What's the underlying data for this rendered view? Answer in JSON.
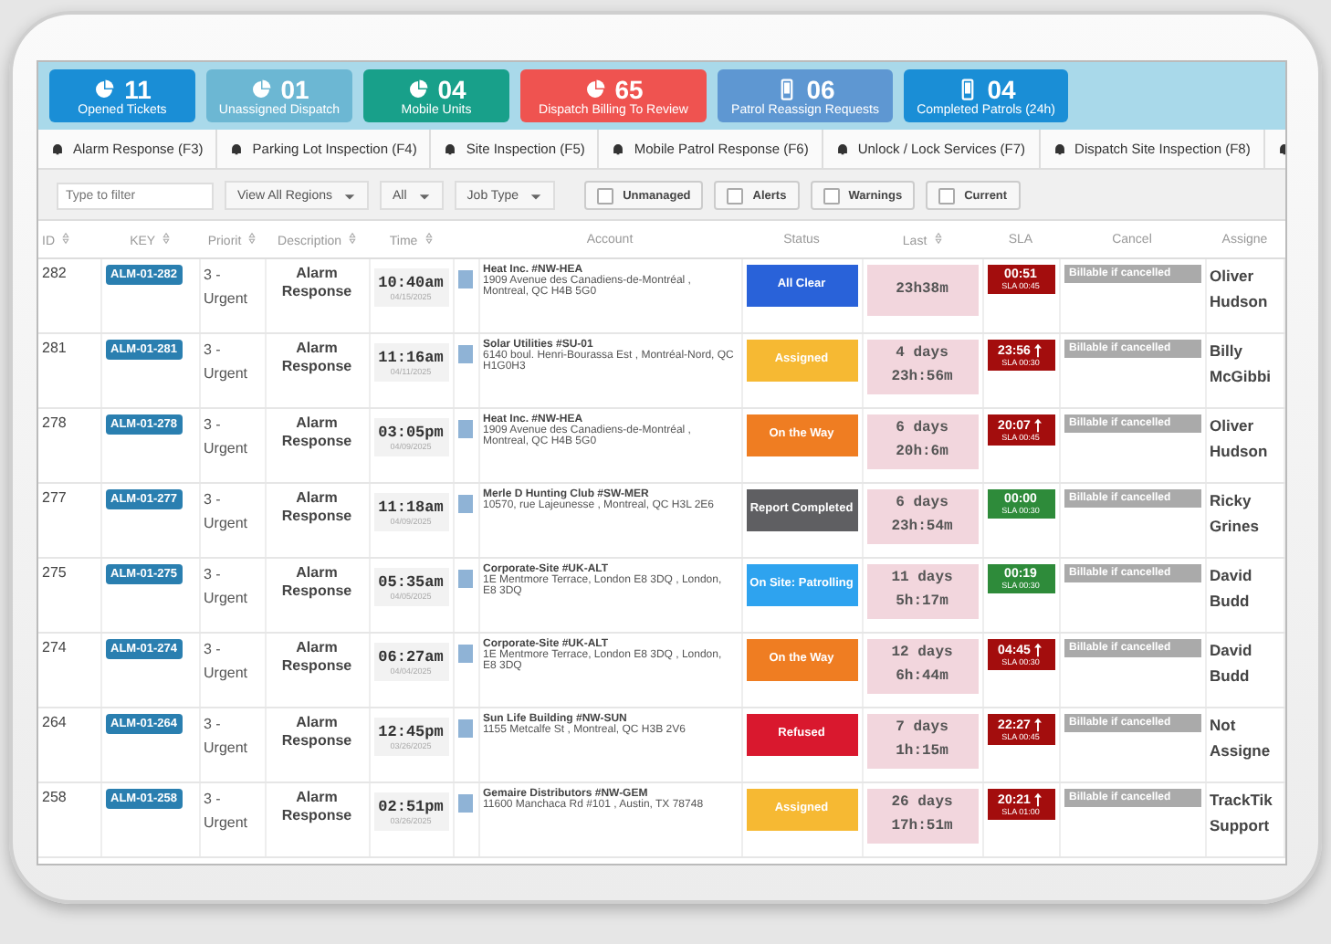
{
  "tiles": [
    {
      "count": "11",
      "label": "Opened Tickets",
      "kind": "pie",
      "color": "#1a8ed6"
    },
    {
      "count": "01",
      "label": "Unassigned Dispatch",
      "kind": "pie",
      "color": "#6cb7d3"
    },
    {
      "count": "04",
      "label": "Mobile Units",
      "kind": "pie",
      "color": "#18a08a"
    },
    {
      "count": "65",
      "label": "Dispatch Billing To Review",
      "kind": "pie",
      "color": "#ef5350"
    },
    {
      "count": "06",
      "label": "Patrol Reassign Requests",
      "kind": "phone",
      "color": "#5e97d2"
    },
    {
      "count": "04",
      "label": "Completed Patrols (24h)",
      "kind": "phone",
      "color": "#1a8ed6"
    }
  ],
  "tabs": [
    {
      "label": "Alarm Response (F3)"
    },
    {
      "label": "Parking Lot Inspection (F4)"
    },
    {
      "label": "Site Inspection (F5)"
    },
    {
      "label": "Mobile Patrol Response (F6)"
    },
    {
      "label": "Unlock / Lock Services (F7)"
    },
    {
      "label": "Dispatch Site Inspection (F8)"
    }
  ],
  "filters": {
    "search": {
      "placeholder": "Type to filter"
    },
    "selects": [
      "View All Regions",
      "All",
      "Job Type"
    ],
    "checkboxes": [
      {
        "label": "Unmanaged",
        "checked": false
      },
      {
        "label": "Alerts",
        "checked": false
      },
      {
        "label": "Warnings",
        "checked": false
      },
      {
        "label": "Current",
        "checked": false
      }
    ]
  },
  "table": {
    "columns": [
      {
        "label": "ID",
        "sortable": true
      },
      {
        "label": "KEY",
        "sortable": true
      },
      {
        "label": "Priorit",
        "sortable": true
      },
      {
        "label": "Description",
        "sortable": true
      },
      {
        "label": "Time",
        "sortable": true
      },
      {
        "sortable": false
      },
      {
        "label": "Account",
        "sortable": false
      },
      {
        "label": "Status",
        "sortable": false
      },
      {
        "label": "Last",
        "sortable": true
      },
      {
        "label": "SLA",
        "sortable": false
      },
      {
        "label": "Cancel",
        "sortable": false
      },
      {
        "label": "Assigne",
        "sortable": false
      }
    ],
    "rows": [
      {
        "id": "282",
        "key": "ALM-01-282",
        "priority": "3 - Urgent",
        "description": "Alarm Response",
        "time": "10:40am",
        "date": "04/15/2025",
        "account_name": "Heat Inc. #NW-HEA",
        "address": "1909 Avenue des Canadiens-de-Montréal , Montreal, QC H4B 5G0",
        "status": {
          "label": "All Clear",
          "color": "#2962d9"
        },
        "last": [
          "23h38m"
        ],
        "sla": {
          "elapsed": "00:51",
          "limit": "SLA 00:45",
          "color": "#a30d0d",
          "overdue": false
        },
        "cancel": "Billable if cancelled",
        "assignee": "Oliver Hudson"
      },
      {
        "id": "281",
        "key": "ALM-01-281",
        "priority": "3 - Urgent",
        "description": "Alarm Response",
        "time": "11:16am",
        "date": "04/11/2025",
        "account_name": "Solar Utilities #SU-01",
        "address": "6140 boul. Henri-Bourassa Est , Montréal-Nord, QC H1G0H3",
        "status": {
          "label": "Assigned",
          "color": "#f6b933"
        },
        "last": [
          "4 days",
          "23h:56m"
        ],
        "sla": {
          "elapsed": "23:56",
          "limit": "SLA 00:30",
          "color": "#a30d0d",
          "overdue": true
        },
        "cancel": "Billable if cancelled",
        "assignee": "Billy McGibbi"
      },
      {
        "id": "278",
        "key": "ALM-01-278",
        "priority": "3 - Urgent",
        "description": "Alarm Response",
        "time": "03:05pm",
        "date": "04/09/2025",
        "account_name": "Heat Inc. #NW-HEA",
        "address": "1909 Avenue des Canadiens-de-Montréal , Montreal, QC H4B 5G0",
        "status": {
          "label": "On the Way",
          "color": "#ef7d22"
        },
        "last": [
          "6 days",
          "20h:6m"
        ],
        "sla": {
          "elapsed": "20:07",
          "limit": "SLA 00:45",
          "color": "#a30d0d",
          "overdue": true
        },
        "cancel": "Billable if cancelled",
        "assignee": "Oliver Hudson"
      },
      {
        "id": "277",
        "key": "ALM-01-277",
        "priority": "3 - Urgent",
        "description": "Alarm Response",
        "time": "11:18am",
        "date": "04/09/2025",
        "account_name": "Merle D Hunting Club #SW-MER",
        "address": "10570, rue Lajeunesse , Montreal, QC H3L 2E6",
        "status": {
          "label": "Report Completed",
          "color": "#5f5f62"
        },
        "last": [
          "6 days",
          "23h:54m"
        ],
        "sla": {
          "elapsed": "00:00",
          "limit": "SLA 00:30",
          "color": "#2e8b3a",
          "overdue": false
        },
        "cancel": "Billable if cancelled",
        "assignee": "Ricky Grines"
      },
      {
        "id": "275",
        "key": "ALM-01-275",
        "priority": "3 - Urgent",
        "description": "Alarm Response",
        "time": "05:35am",
        "date": "04/05/2025",
        "account_name": "Corporate-Site #UK-ALT",
        "address": "1E Mentmore Terrace, London E8 3DQ , London, E8 3DQ",
        "status": {
          "label": "On Site: Patrolling",
          "color": "#2ea3ef"
        },
        "last": [
          "11 days",
          "5h:17m"
        ],
        "sla": {
          "elapsed": "00:19",
          "limit": "SLA 00:30",
          "color": "#2e8b3a",
          "overdue": false
        },
        "cancel": "Billable if cancelled",
        "assignee": "David Budd"
      },
      {
        "id": "274",
        "key": "ALM-01-274",
        "priority": "3 - Urgent",
        "description": "Alarm Response",
        "time": "06:27am",
        "date": "04/04/2025",
        "account_name": "Corporate-Site #UK-ALT",
        "address": "1E Mentmore Terrace, London E8 3DQ , London, E8 3DQ",
        "status": {
          "label": "On the Way",
          "color": "#ef7d22"
        },
        "last": [
          "12 days",
          "6h:44m"
        ],
        "sla": {
          "elapsed": "04:45",
          "limit": "SLA 00:30",
          "color": "#a30d0d",
          "overdue": true
        },
        "cancel": "Billable if cancelled",
        "assignee": "David Budd"
      },
      {
        "id": "264",
        "key": "ALM-01-264",
        "priority": "3 - Urgent",
        "description": "Alarm Response",
        "time": "12:45pm",
        "date": "03/26/2025",
        "account_name": "Sun Life Building #NW-SUN",
        "address": "1155 Metcalfe St , Montreal, QC H3B 2V6",
        "status": {
          "label": "Refused",
          "color": "#d9182e"
        },
        "last": [
          "7 days",
          "1h:15m"
        ],
        "sla": {
          "elapsed": "22:27",
          "limit": "SLA 00:45",
          "color": "#a30d0d",
          "overdue": true
        },
        "cancel": "Billable if cancelled",
        "assignee": "Not Assigne"
      },
      {
        "id": "258",
        "key": "ALM-01-258",
        "priority": "3 - Urgent",
        "description": "Alarm Response",
        "time": "02:51pm",
        "date": "03/26/2025",
        "account_name": "Gemaire Distributors #NW-GEM",
        "address": "11600 Manchaca Rd #101 , Austin, TX 78748",
        "status": {
          "label": "Assigned",
          "color": "#f6b933"
        },
        "last": [
          "26 days",
          "17h:51m"
        ],
        "sla": {
          "elapsed": "20:21",
          "limit": "SLA 01:00",
          "color": "#a30d0d",
          "overdue": true
        },
        "cancel": "Billable if cancelled",
        "assignee": "TrackTik Support"
      }
    ]
  }
}
